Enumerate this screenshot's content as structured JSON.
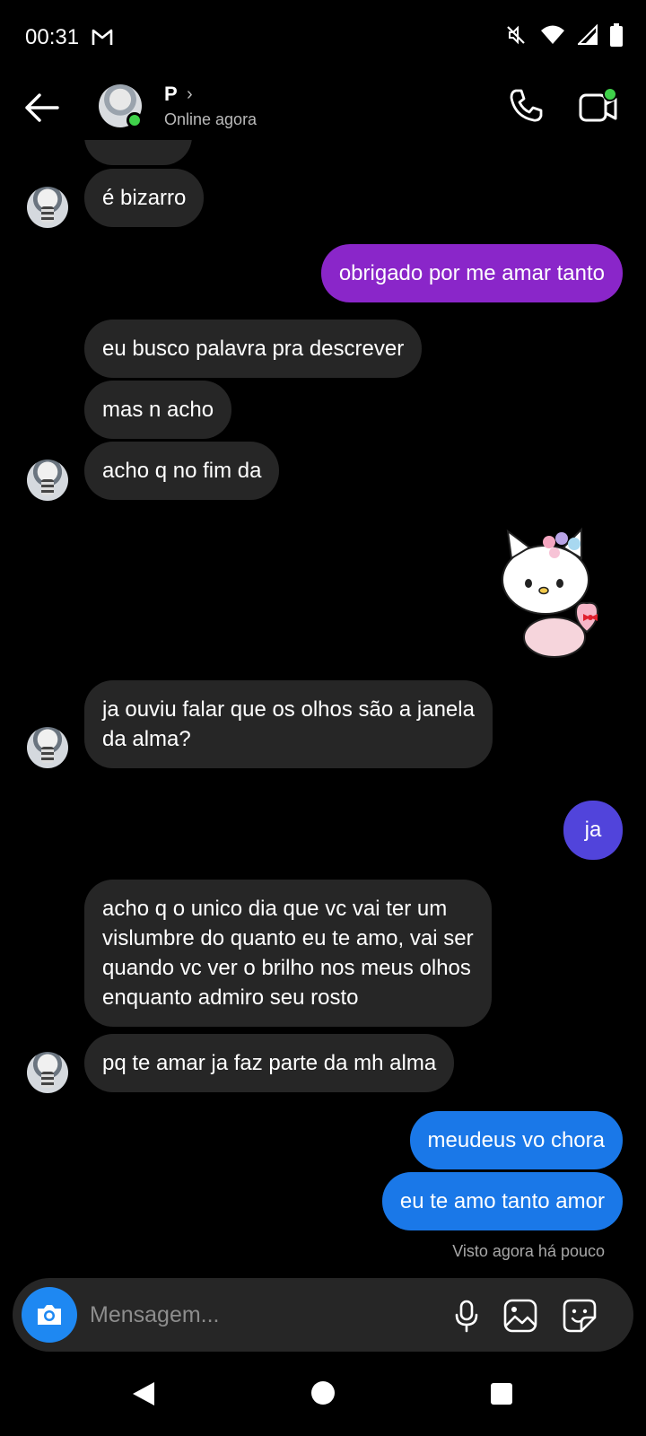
{
  "status_bar": {
    "time": "00:31"
  },
  "header": {
    "name": "P",
    "status": "Online agora"
  },
  "messages": [
    {
      "from": "them",
      "text": "é bizarro"
    },
    {
      "from": "me",
      "text": "obrigado por me amar tanto",
      "color": "#8a26c9"
    },
    {
      "from": "them",
      "text": "eu busco palavra pra descrever"
    },
    {
      "from": "them",
      "text": "mas n acho"
    },
    {
      "from": "them",
      "text": "acho q no fim da"
    },
    {
      "from": "me",
      "sticker": "hello-kitty-heart-box"
    },
    {
      "from": "them",
      "text": "ja ouviu falar que os olhos são a janela\nda alma?"
    },
    {
      "from": "me",
      "text": "ja",
      "color": "#5144db"
    },
    {
      "from": "them",
      "text": "acho q o unico dia que vc vai ter um\nvislumbre do quanto eu te amo, vai ser\nquando vc ver o brilho nos meus olhos\nenquanto admiro seu rosto"
    },
    {
      "from": "them",
      "text": "pq te amar ja faz parte da mh alma"
    },
    {
      "from": "me",
      "text": "meudeus vo chora",
      "color": "#1a78e8"
    },
    {
      "from": "me",
      "text": "eu te amo tanto amor",
      "color": "#1a78e8"
    }
  ],
  "seen_text": "Visto agora há pouco",
  "composer": {
    "placeholder": "Mensagem..."
  },
  "colors": {
    "online": "#3fd14a",
    "camera": "#1e88f2",
    "bubble_in": "#262626"
  }
}
